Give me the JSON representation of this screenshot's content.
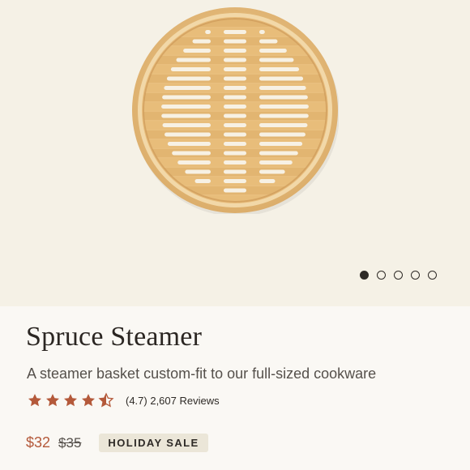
{
  "product": {
    "title": "Spruce Steamer",
    "description": "A steamer basket custom-fit to our full-sized cookware",
    "rating": 4.7,
    "rating_text": "(4.7) 2,607 Reviews",
    "price": "$32",
    "original_price": "$35",
    "badge": "HOLIDAY SALE"
  },
  "gallery": {
    "image": "bamboo-steamer-image",
    "slide_count": 5,
    "active_slide": 1
  },
  "colors": {
    "accent": "#b4593a",
    "hero_bg": "#f5f1e6",
    "badge_bg": "#ebe6d8"
  }
}
